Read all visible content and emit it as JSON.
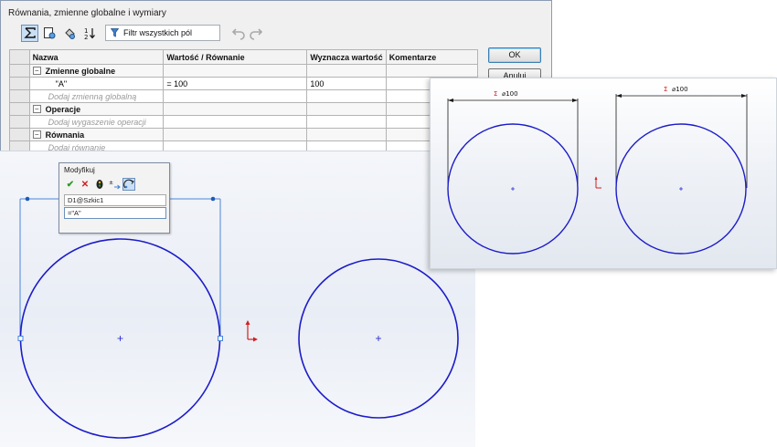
{
  "dialog": {
    "title": "Równania, zmienne globalne i wymiary",
    "filter_placeholder": "Filtr wszystkich pól",
    "toolbar_icons": [
      "sigma-equations-icon",
      "sketch-view-icon",
      "dimension-view-icon",
      "ordered-view-icon",
      "undo-icon",
      "redo-icon"
    ],
    "columns": [
      "Nazwa",
      "Wartość / Równanie",
      "Wyznacza wartość",
      "Komentarze"
    ],
    "groups": {
      "globals": {
        "label": "Zmienne globalne"
      },
      "features": {
        "label": "Operacje"
      },
      "equations": {
        "label": "Równania"
      }
    },
    "global_var": {
      "name": "\"A\"",
      "equation": "= 100",
      "value": "100",
      "comment": ""
    },
    "hints": {
      "add_global": "Dodaj zmienną globalną",
      "add_suppression": "Dodaj wygaszenie operacji",
      "add_equation": "Dodaj równanie"
    },
    "ok_label": "OK",
    "cancel_label": "Anuluj"
  },
  "modify": {
    "title": "Modyfikuj",
    "icons": [
      "accept-icon",
      "cancel-icon",
      "rebuild-icon",
      "reverse-icon",
      "mark-for-drawing-icon"
    ],
    "dimension_name": "D1@Szkic1",
    "value_input": "=\"A\""
  },
  "right_view": {
    "dim_left": "⌀100",
    "dim_right": "⌀100",
    "sigma_symbol": "Σ"
  },
  "colors": {
    "circle": "#1c1cc8",
    "dimension": "#1a1a1a",
    "origin": "#d21f1f",
    "selection": "#4b86d8"
  }
}
